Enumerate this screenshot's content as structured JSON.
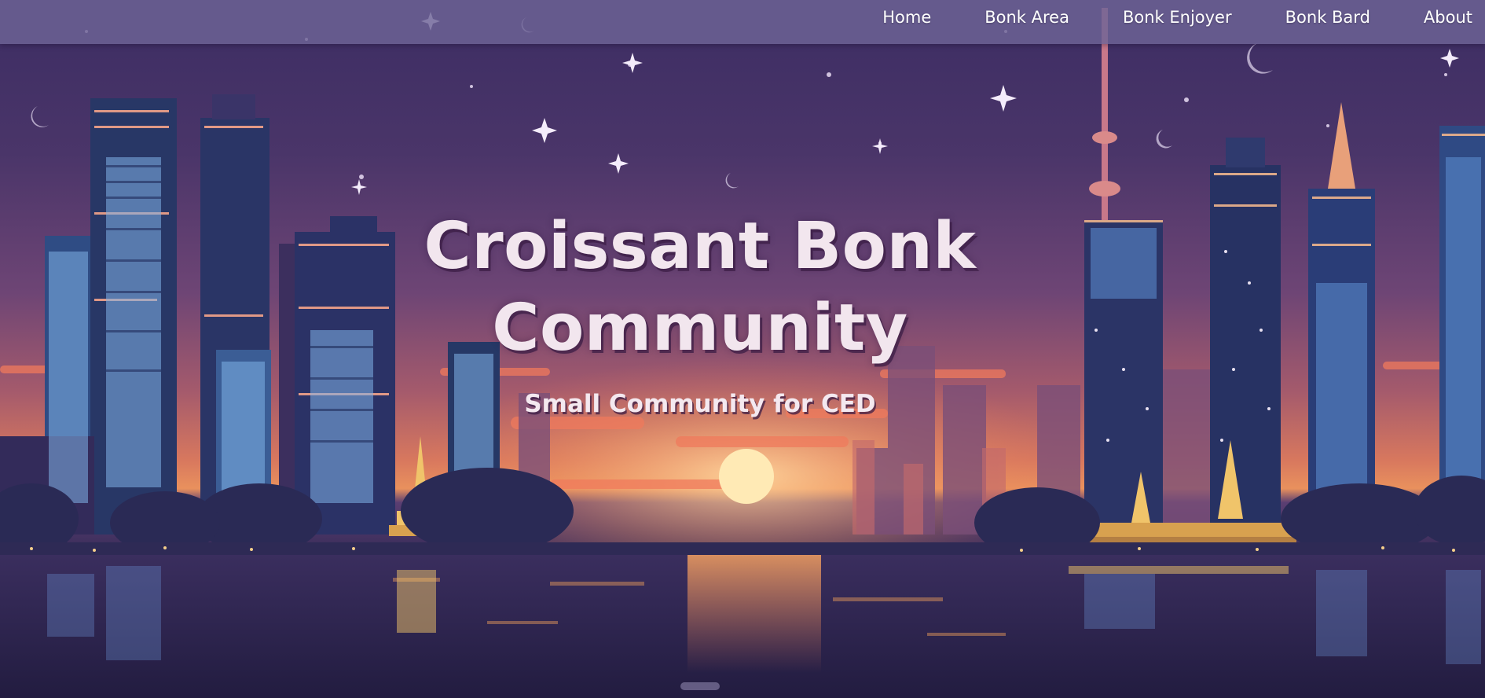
{
  "nav": {
    "items": [
      {
        "label": "Home"
      },
      {
        "label": "Bonk Area"
      },
      {
        "label": "Bonk Enjoyer"
      },
      {
        "label": "Bonk Bard"
      },
      {
        "label": "About"
      }
    ]
  },
  "hero": {
    "title_line1": "Croissant Bonk",
    "title_line2": "Community",
    "subtitle": "Small Community for CED"
  },
  "colors": {
    "navbar": "#6e6496",
    "title": "#f2e6ee",
    "sky_top": "#3c2d63",
    "horizon": "#e9915d",
    "water": "#241f45"
  },
  "icons": {
    "background": "city-skyline-illustration"
  }
}
